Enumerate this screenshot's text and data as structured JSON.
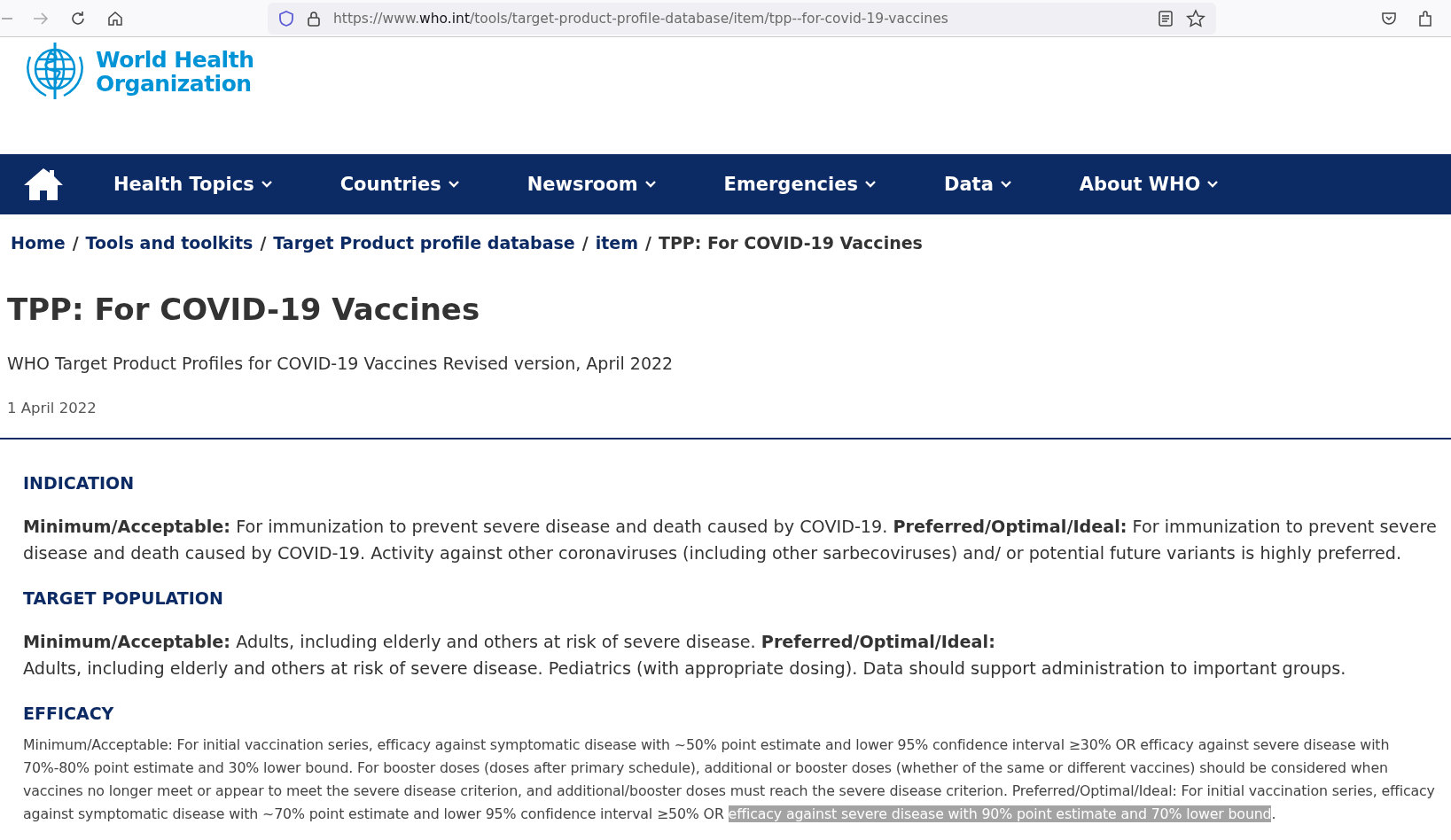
{
  "browser": {
    "url_prefix": "https://www.",
    "url_domain": "who.int",
    "url_path": "/tools/target-product-profile-database/item/tpp--for-covid-19-vaccines"
  },
  "logo": {
    "line_1": "World Health",
    "line_2": "Organization"
  },
  "nav": {
    "items": [
      {
        "label": "Health Topics"
      },
      {
        "label": "Countries"
      },
      {
        "label": "Newsroom"
      },
      {
        "label": "Emergencies"
      },
      {
        "label": "Data"
      },
      {
        "label": "About WHO"
      }
    ]
  },
  "breadcrumb_separator": "/",
  "breadcrumb": [
    {
      "label": "Home",
      "link": true
    },
    {
      "label": "Tools and toolkits",
      "link": true
    },
    {
      "label": "Target Product profile database",
      "link": true
    },
    {
      "label": "item",
      "link": true
    },
    {
      "label": "TPP: For COVID-19 Vaccines",
      "link": false
    }
  ],
  "page": {
    "title": "TPP: For COVID-19 Vaccines",
    "subtitle": "WHO Target Product Profiles for COVID-19 Vaccines Revised version, April 2022",
    "date": "1 April 2022"
  },
  "sections": [
    {
      "heading": "INDICATION",
      "kind": "rich",
      "paragraphs": [
        "**Minimum/Acceptable:** For immunization to prevent severe disease and death caused by COVID-19.  **Preferred/Optimal/Ideal:** For immunization to prevent severe disease and death caused by COVID-19. Activity against other coronaviruses (including other sarbecoviruses) and/ or potential future variants is highly preferred."
      ]
    },
    {
      "heading": "TARGET POPULATION",
      "kind": "rich",
      "paragraphs": [
        "**Minimum/Acceptable:** Adults, including elderly and others at risk of severe disease. **Preferred/Optimal/Ideal:**",
        "Adults, including elderly and others at risk of severe disease. Pediatrics (with appropriate dosing). Data should support administration to important groups."
      ]
    },
    {
      "heading": "EFFICACY",
      "kind": "plain",
      "segments": [
        {
          "text": "Minimum/Acceptable: For initial vaccination series, efficacy against symptomatic disease with ~50% point estimate and lower 95% confidence interval ≥30% OR efficacy against severe disease with 70%-80% point estimate and 30% lower bound. For booster doses (doses after primary schedule), additional or booster doses (whether of the same or different vaccines) should be considered when vaccines no longer meet or appear to meet the severe disease criterion, and additional/booster doses must reach the severe disease criterion. Preferred/Optimal/Ideal: For initial vaccination series, efficacy against symptomatic disease with ~70% point estimate and lower 95% confidence interval ≥50% OR ",
          "selected": false
        },
        {
          "text": "efficacy against severe disease with 90% point estimate and 70% lower bound",
          "selected": true
        },
        {
          "text": ".",
          "selected": false
        }
      ]
    }
  ]
}
